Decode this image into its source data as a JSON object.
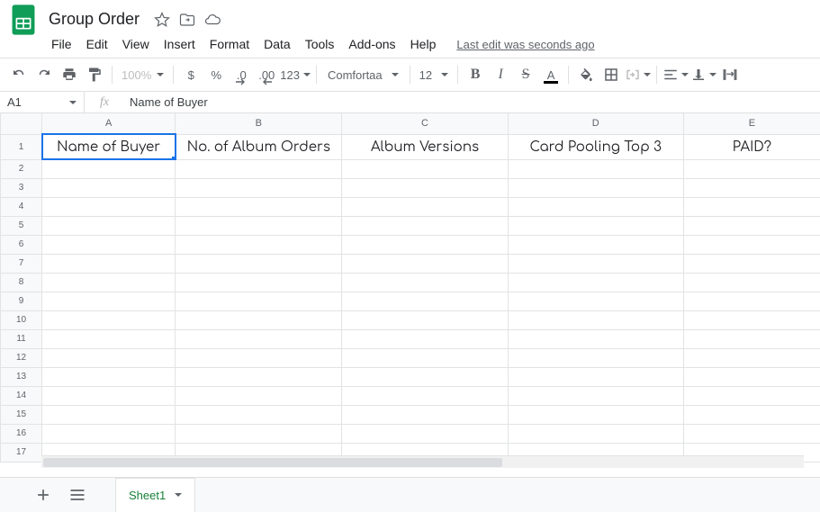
{
  "doc": {
    "title": "Group Order"
  },
  "menu": {
    "file": "File",
    "edit": "Edit",
    "view": "View",
    "insert": "Insert",
    "format": "Format",
    "data": "Data",
    "tools": "Tools",
    "addons": "Add-ons",
    "help": "Help",
    "last_edit": "Last edit was seconds ago"
  },
  "toolbar": {
    "zoom": "100%",
    "currency": "$",
    "percent": "%",
    "dec_dec": ".0",
    "inc_dec": ".00",
    "numfmt": "123",
    "font": "Comfortaa",
    "size": "12",
    "bold": "B",
    "italic": "I",
    "strike": "S",
    "textcolor": "A"
  },
  "namebox": {
    "ref": "A1"
  },
  "formula": {
    "value": "Name of Buyer"
  },
  "columns": [
    "A",
    "B",
    "C",
    "D",
    "E"
  ],
  "rows": [
    "1",
    "2",
    "3",
    "4",
    "5",
    "6",
    "7",
    "8",
    "9",
    "10",
    "11",
    "12",
    "13",
    "14",
    "15",
    "16",
    "17"
  ],
  "cells": {
    "A1": "Name of Buyer",
    "B1": "No. of Album Orders",
    "C1": "Album Versions",
    "D1": "Card Pooling Top 3",
    "E1": "PAID?"
  },
  "tabs": {
    "sheet1": "Sheet1"
  }
}
